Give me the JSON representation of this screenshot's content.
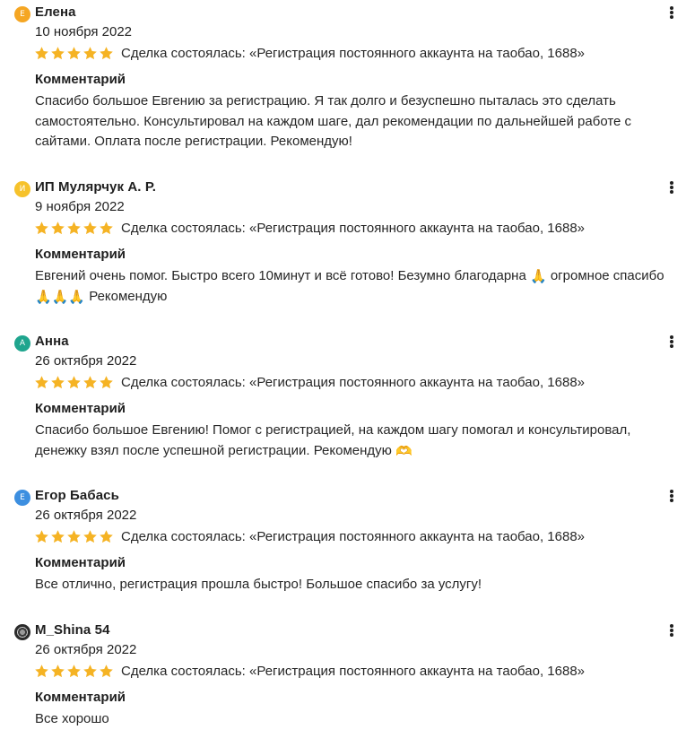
{
  "labels": {
    "deal": "Сделка состоялась: «Регистрация постоянного аккаунта на таобао, 1688»",
    "comment_title": "Комментарий"
  },
  "colors": {
    "star": "#F5B324",
    "avatar_e": "#F5A623",
    "avatar_i": "#F6C22B",
    "avatar_a": "#1FA58E",
    "avatar_e2": "#3D8FE0"
  },
  "reviews": [
    {
      "avatar_letter": "Е",
      "avatar_icon": "letter-avatar",
      "name": "Елена",
      "date": "10 ноября 2022",
      "rating": 5,
      "comment": "Спасибо большое Евгению за регистрацию. Я так долго и безуспешно пыталась это сделать самостоятельно. Консультировал на каждом шаге, дал рекомендации по дальнейшей работе с сайтами. Оплата после регистрации. Рекомендую!"
    },
    {
      "avatar_letter": "И",
      "avatar_icon": "letter-avatar",
      "name": "ИП Мулярчук А. Р.",
      "date": "9 ноября 2022",
      "rating": 5,
      "comment_part1": "Евгений очень помог. Быстро всего 10минут и всё готово! Безумно благодарна",
      "comment_part2": "огромное спасибо",
      "comment_part3": "Рекомендую",
      "emoji": "🙏"
    },
    {
      "avatar_letter": "А",
      "avatar_icon": "letter-avatar",
      "name": "Анна",
      "date": "26 октября 2022",
      "rating": 5,
      "comment": "Спасибо большое Евгению! Помог с регистрацией, на каждом шагу помогал и консультировал, денежку взял после успешной регистрации. Рекомендую",
      "emoji": "🫶"
    },
    {
      "avatar_letter": "Е",
      "avatar_icon": "letter-avatar",
      "name": "Егор Бабась",
      "date": "26 октября 2022",
      "rating": 5,
      "comment": "Все отлично, регистрация прошла быстро! Большое спасибо за услугу!"
    },
    {
      "avatar_letter": "",
      "avatar_icon": "photo-avatar",
      "name": "M_Shina 54",
      "date": "26 октября 2022",
      "rating": 5,
      "comment": "Все хорошо"
    }
  ]
}
